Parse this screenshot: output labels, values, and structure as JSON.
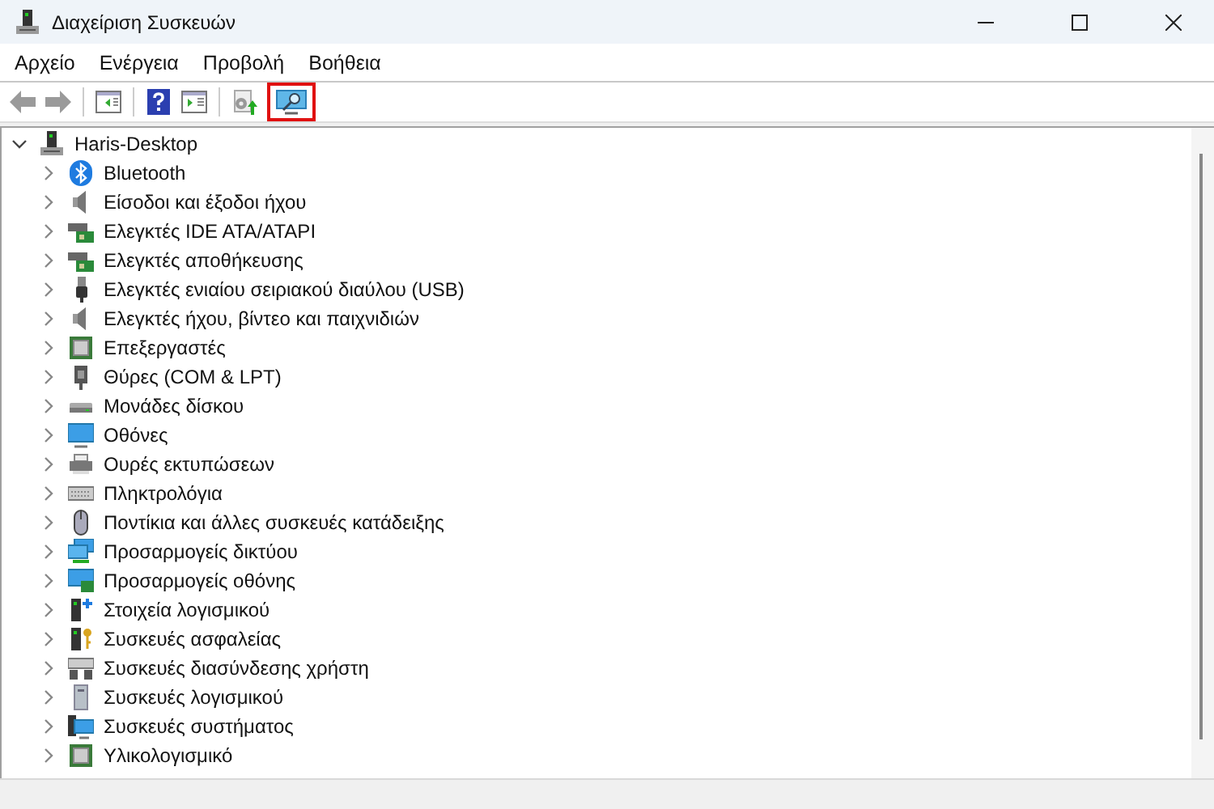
{
  "window": {
    "title": "Διαχείριση Συσκευών"
  },
  "menu": [
    "Αρχείο",
    "Ενέργεια",
    "Προβολή",
    "Βοήθεια"
  ],
  "toolbar": [
    {
      "kind": "back",
      "highlighted": false
    },
    {
      "kind": "forward",
      "highlighted": false
    },
    {
      "kind": "separator"
    },
    {
      "kind": "panel-left",
      "highlighted": false
    },
    {
      "kind": "separator"
    },
    {
      "kind": "help",
      "highlighted": false
    },
    {
      "kind": "panel-right",
      "highlighted": false
    },
    {
      "kind": "separator"
    },
    {
      "kind": "update",
      "highlighted": false
    },
    {
      "kind": "scan",
      "highlighted": true
    }
  ],
  "tree": {
    "label": "Haris-Desktop",
    "expanded": true,
    "children": [
      {
        "label": "Bluetooth",
        "expanded": false
      },
      {
        "label": "Είσοδοι και έξοδοι ήχου",
        "expanded": false
      },
      {
        "label": "Ελεγκτές IDE ATA/ATAPI",
        "expanded": false
      },
      {
        "label": "Ελεγκτές αποθήκευσης",
        "expanded": false
      },
      {
        "label": "Ελεγκτές ενιαίου σειριακού διαύλου (USB)",
        "expanded": false
      },
      {
        "label": "Ελεγκτές ήχου, βίντεο και παιχνιδιών",
        "expanded": false
      },
      {
        "label": "Επεξεργαστές",
        "expanded": false
      },
      {
        "label": "Θύρες (COM & LPT)",
        "expanded": false
      },
      {
        "label": "Μονάδες δίσκου",
        "expanded": false
      },
      {
        "label": "Οθόνες",
        "expanded": false
      },
      {
        "label": "Ουρές εκτυπώσεων",
        "expanded": false
      },
      {
        "label": "Πληκτρολόγια",
        "expanded": false
      },
      {
        "label": "Ποντίκια και άλλες συσκευές κατάδειξης",
        "expanded": false
      },
      {
        "label": "Προσαρμογείς δικτύου",
        "expanded": false
      },
      {
        "label": "Προσαρμογείς οθόνης",
        "expanded": false
      },
      {
        "label": "Στοιχεία λογισμικού",
        "expanded": false
      },
      {
        "label": "Συσκευές ασφαλείας",
        "expanded": false
      },
      {
        "label": "Συσκευές διασύνδεσης χρήστη",
        "expanded": false
      },
      {
        "label": "Συσκευές λογισμικού",
        "expanded": false
      },
      {
        "label": "Συσκευές συστήματος",
        "expanded": false
      },
      {
        "label": "Υλικολογισμικό",
        "expanded": false
      }
    ]
  }
}
